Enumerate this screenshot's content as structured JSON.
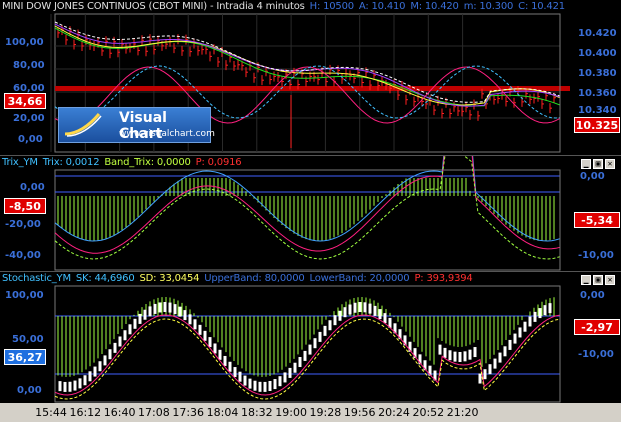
{
  "panels": {
    "price": {
      "title_parts": [
        {
          "text": "MINI DOW JONES CONTINUOS (CBOT MINI) - Intradia 4 minutos",
          "color": "#e0e0e0"
        },
        {
          "text": "H: 10500",
          "color": "#3a6fd8"
        },
        {
          "text": "A: 10.410",
          "color": "#3a6fd8"
        },
        {
          "text": "M: 10.420",
          "color": "#3a6fd8"
        },
        {
          "text": "m: 10.300",
          "color": "#3a6fd8"
        },
        {
          "text": "C: 10.421",
          "color": "#3a6fd8"
        }
      ],
      "left_ticks": [
        "100,00",
        "80,00",
        "60,00",
        "20,00",
        "0,00"
      ],
      "right_ticks": [
        "10.420",
        "10.400",
        "10.380",
        "10.360",
        "10.340"
      ],
      "left_value": "34,66",
      "right_value": "10.325"
    },
    "trix": {
      "title_parts": [
        {
          "text": "Trix_YM",
          "color": "#40c0ff"
        },
        {
          "text": "Trix: 0,0012",
          "color": "#40c0ff"
        },
        {
          "text": "Band_Trix: 0,0000",
          "color": "#c0ff40"
        },
        {
          "text": "P: 0,0916",
          "color": "#ff3030"
        }
      ],
      "left_ticks": [
        "0,00",
        "-20,00",
        "-40,00"
      ],
      "right_ticks": [
        "0,00",
        "-10,00"
      ],
      "left_value": "-8,50",
      "right_value": "-5,34"
    },
    "stoch": {
      "title_parts": [
        {
          "text": "Stochastic_YM",
          "color": "#40c0ff"
        },
        {
          "text": "SK: 44,6960",
          "color": "#40c0ff"
        },
        {
          "text": "SD: 33,0454",
          "color": "#ffff60"
        },
        {
          "text": "UpperBand: 80,0000",
          "color": "#3a6fd8"
        },
        {
          "text": "LowerBand: 20,0000",
          "color": "#3a6fd8"
        },
        {
          "text": "P: 393,9394",
          "color": "#ff3030"
        }
      ],
      "left_ticks": [
        "100,00",
        "50,00",
        "0,00"
      ],
      "right_ticks": [
        "0,00",
        "-10,00"
      ],
      "left_value": "36,27",
      "right_value": "-2,97"
    }
  },
  "logo": {
    "name": "Visual Chart",
    "url": "www.visualchart.com"
  },
  "window_buttons": [
    "▁",
    "▣",
    "✕"
  ],
  "x_axis": [
    "15:44",
    "16:12",
    "16:40",
    "17:08",
    "17:36",
    "18:04",
    "18:32",
    "19:00",
    "19:28",
    "19:56",
    "20:24",
    "20:52",
    "21:20"
  ],
  "colors": {
    "background": "#000000",
    "red_label": "#e00000",
    "blue_label": "#1e6fe0",
    "grid": "#303030"
  }
}
